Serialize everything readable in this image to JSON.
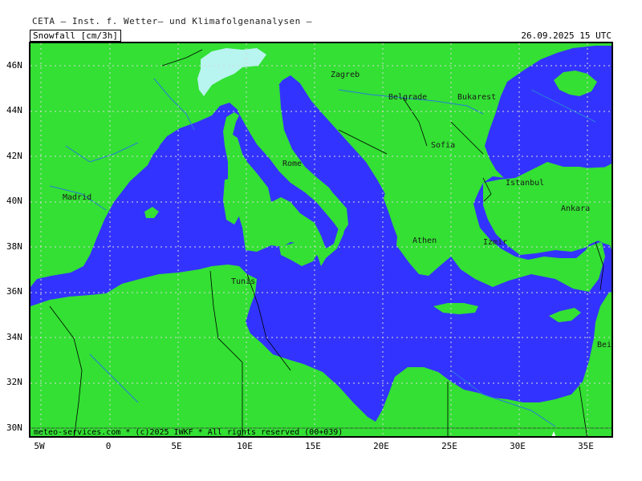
{
  "header": {
    "institute": "CETA — Inst. f. Wetter— und Klimafolgenanalysen —",
    "parameter": "Snowfall [cm/3h]",
    "datetime": "26.09.2025 15 UTC"
  },
  "map": {
    "colors": {
      "land": "#33e033",
      "sea": "#3333ff",
      "snow": "#b8f4f0",
      "rivers": "#2a7bd8",
      "borders": "#000000",
      "grid": "#d8d8d8"
    },
    "lat_labels": [
      "46N",
      "44N",
      "42N",
      "40N",
      "38N",
      "36N",
      "34N",
      "32N",
      "30N"
    ],
    "lon_labels": [
      "5W",
      "0",
      "5E",
      "10E",
      "15E",
      "20E",
      "25E",
      "30E",
      "35E"
    ],
    "cities": [
      "Zagreb",
      "Belgrade",
      "Bukarest",
      "Sofia",
      "Rome",
      "Istanbul",
      "Madrid",
      "Ankara",
      "Athen",
      "Izmir",
      "Tunis",
      "Beirut"
    ],
    "footer": "meteo-services.com * (c)2025 IWKF * All rights reserved (00+039)"
  }
}
